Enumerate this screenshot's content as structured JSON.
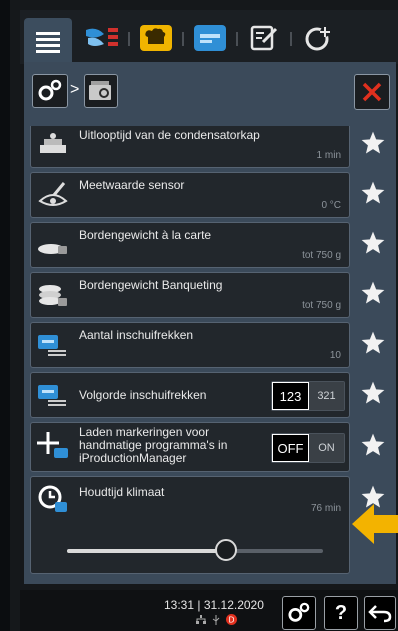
{
  "settings_rows": [
    {
      "label": "Uitlooptijd van de condensatorkap",
      "value": "1 min",
      "icon": "condenser-hood-icon"
    },
    {
      "label": "Meetwaarde sensor",
      "value": "0 °C",
      "icon": "sensor-eye-icon"
    },
    {
      "label": "Bordengewicht à la carte",
      "value": "tot 750 g",
      "icon": "plate-weight-icon"
    },
    {
      "label": "Bordengewicht Banqueting",
      "value": "tot 750 g",
      "icon": "plate-stack-weight-icon"
    },
    {
      "label": "Aantal inschuifrekken",
      "value": "10",
      "icon": "rack-count-icon"
    }
  ],
  "rack_order": {
    "label": "Volgorde inschuifrekken",
    "options": [
      "123",
      "321"
    ],
    "selected": "123"
  },
  "markings": {
    "label": "Laden markeringen voor handmatige programma's in iProductionManager",
    "options": [
      "OFF",
      "ON"
    ],
    "selected": "OFF"
  },
  "climate_hold": {
    "label": "Houdtijd klimaat",
    "value": "76 min",
    "slider_fraction": 0.62
  },
  "footer": {
    "time": "13:31",
    "separator": "|",
    "date": "31.12.2020"
  },
  "colors": {
    "accent_close": "#e0301e",
    "arrow": "#f3b300",
    "tab_blue": "#2f8fd6",
    "tab_yellow": "#f0b400"
  }
}
